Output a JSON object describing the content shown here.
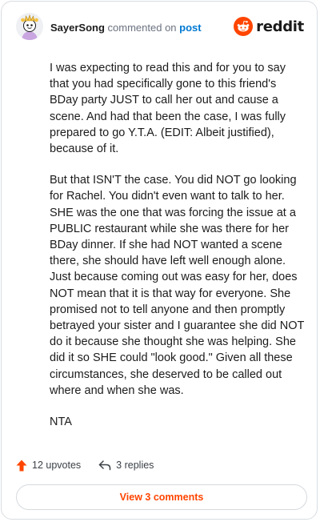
{
  "header": {
    "username": "SayerSong",
    "commented_text": "commented on",
    "post_link": "post",
    "brand": "reddit"
  },
  "comment": {
    "paragraphs": [
      "I was expecting to read this and for you to say that you had specifically gone to this friend's BDay party JUST to call her out and cause a scene. And had that been the case, I was fully prepared to go Y.T.A. (EDIT: Albeit justified), because of it.",
      "But that ISN'T the case. You did NOT go looking for Rachel. You didn't even want to talk to her. SHE was the one that was forcing the issue at a PUBLIC restaurant while she was there for her BDay dinner. If she had NOT wanted a scene there, she should have left well enough alone. Just because coming out was easy for her, does NOT mean that it is that way for everyone. She promised not to tell anyone and then promptly betrayed your sister and I guarantee she did NOT do it because she thought she was helping. She did it so SHE could \"look good.\" Given all these circumstances, she deserved to be called out where and when she was.",
      "NTA"
    ]
  },
  "actions": {
    "upvotes": "12 upvotes",
    "replies": "3 replies"
  },
  "view_button": "View 3 comments",
  "colors": {
    "brand_orange": "#ff4500",
    "link_blue": "#0079d3"
  },
  "icons": {
    "avatar": "snoo-avatar",
    "logo": "reddit-logo-icon",
    "upvote": "upvote-arrow-icon",
    "reply": "reply-arrow-icon"
  }
}
